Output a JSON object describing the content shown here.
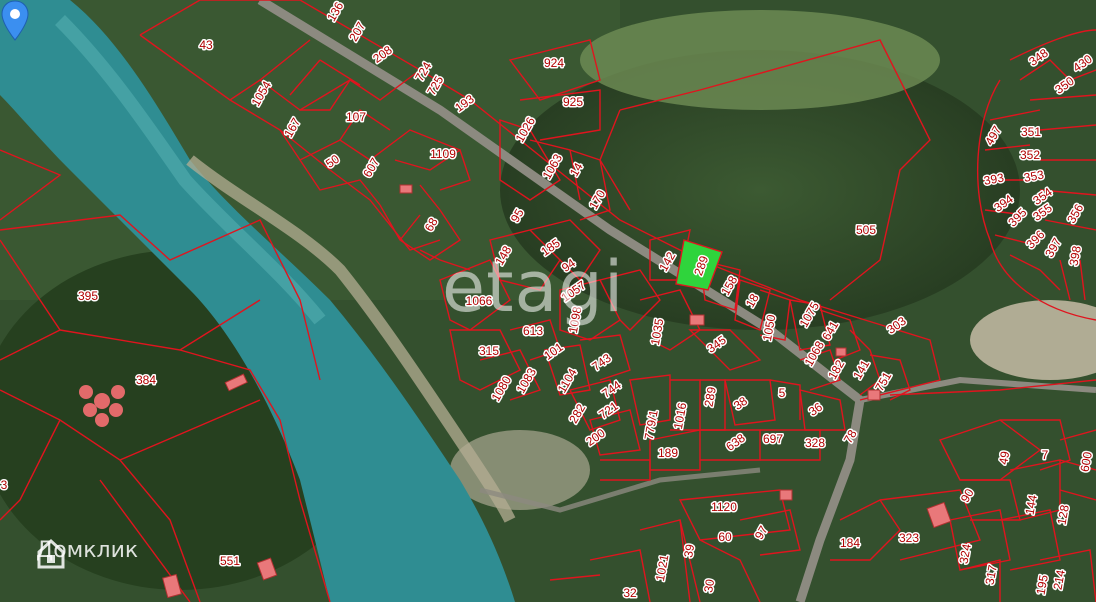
{
  "map": {
    "parcel_line_color": "#e0141e",
    "selected_parcel_color": "#2fd43c",
    "pin_color": "#3b8ff0",
    "watermark_text": "etagi",
    "brand_text": "Домклик",
    "brand_icon": "house-logo-icon",
    "selected_parcel_label": "289",
    "parcel_labels": [
      "136",
      "207",
      "208",
      "724",
      "725",
      "193",
      "43",
      "1054",
      "107",
      "167",
      "50",
      "607",
      "1109",
      "924",
      "925",
      "1026",
      "1063",
      "14",
      "170",
      "95",
      "68",
      "148",
      "185",
      "94",
      "142",
      "158",
      "18",
      "1057",
      "1066",
      "613",
      "1098",
      "1035",
      "1050",
      "1075",
      "641",
      "303",
      "505",
      "315",
      "101",
      "1104",
      "743",
      "345",
      "1068",
      "182",
      "141",
      "751",
      "1080",
      "1083",
      "744",
      "282",
      "721",
      "779/1",
      "1016",
      "289",
      "38",
      "5",
      "36",
      "200",
      "638",
      "697",
      "328",
      "78",
      "189",
      "395",
      "384",
      "551",
      "3",
      "1120",
      "60",
      "97",
      "184",
      "323",
      "1021",
      "39",
      "30",
      "32",
      "348",
      "430",
      "350",
      "497",
      "351",
      "352",
      "393",
      "353",
      "394",
      "354",
      "355",
      "395",
      "356",
      "396",
      "397",
      "398",
      "49",
      "7",
      "600",
      "90",
      "144",
      "128",
      "324",
      "317",
      "195",
      "214"
    ]
  }
}
